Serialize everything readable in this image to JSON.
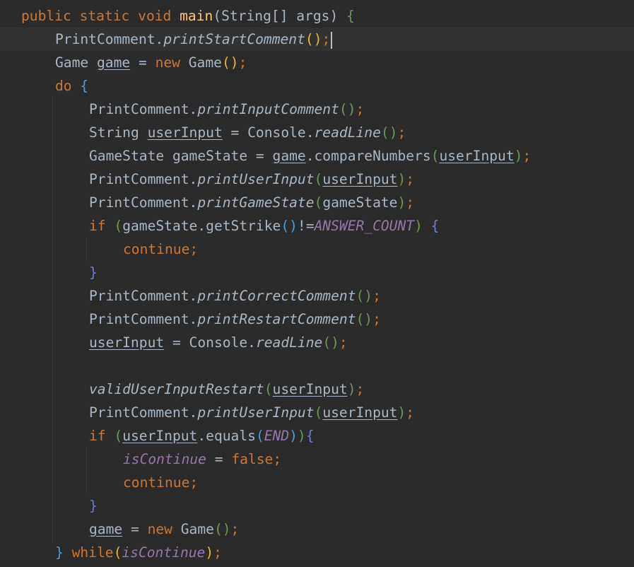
{
  "editor": {
    "lines": [
      {
        "id": "main-signature",
        "tokens": [
          "public",
          " ",
          "static",
          " ",
          "void",
          " ",
          "main",
          "(",
          "String[] args",
          ")",
          " ",
          "{"
        ]
      },
      {
        "id": "print-start",
        "tokens": [
          "PrintComment.",
          "printStartComment",
          "(",
          ")",
          ";"
        ]
      },
      {
        "id": "game-new",
        "tokens": [
          "Game ",
          "game",
          " = ",
          "new",
          " Game",
          "(",
          ")",
          ";"
        ]
      },
      {
        "id": "do-open",
        "tokens": [
          "do",
          " ",
          "{"
        ]
      },
      {
        "id": "print-input",
        "tokens": [
          "PrintComment.",
          "printInputComment",
          "(",
          ")",
          ";"
        ]
      },
      {
        "id": "read-input",
        "tokens": [
          "String ",
          "userInput",
          " = Console.",
          "readLine",
          "(",
          ")",
          ";"
        ]
      },
      {
        "id": "compare",
        "tokens": [
          "GameState gameState = ",
          "game",
          ".compareNumbers",
          "(",
          "userInput",
          ")",
          ";"
        ]
      },
      {
        "id": "print-user-input",
        "tokens": [
          "PrintComment.",
          "printUserInput",
          "(",
          "userInput",
          ")",
          ";"
        ]
      },
      {
        "id": "print-game-state",
        "tokens": [
          "PrintComment.",
          "printGameState",
          "(",
          "gameState",
          ")",
          ";"
        ]
      },
      {
        "id": "if-strike",
        "tokens": [
          "if",
          " ",
          "(",
          "gameState.getStrike",
          "(",
          ")",
          "!=",
          "ANSWER_COUNT",
          ")",
          " ",
          "{"
        ]
      },
      {
        "id": "continue-1",
        "tokens": [
          "continue",
          ";"
        ]
      },
      {
        "id": "close-if-1",
        "tokens": [
          "}"
        ]
      },
      {
        "id": "print-correct",
        "tokens": [
          "PrintComment.",
          "printCorrectComment",
          "(",
          ")",
          ";"
        ]
      },
      {
        "id": "print-restart",
        "tokens": [
          "PrintComment.",
          "printRestartComment",
          "(",
          ")",
          ";"
        ]
      },
      {
        "id": "reread-input",
        "tokens": [
          "userInput",
          " = Console.",
          "readLine",
          "(",
          ")",
          ";"
        ]
      },
      {
        "id": "blank",
        "tokens": [
          ""
        ]
      },
      {
        "id": "valid-restart",
        "tokens": [
          "validUserInputRestart",
          "(",
          "userInput",
          ")",
          ";"
        ]
      },
      {
        "id": "print-user-input-2",
        "tokens": [
          "PrintComment.",
          "printUserInput",
          "(",
          "userInput",
          ")",
          ";"
        ]
      },
      {
        "id": "if-end",
        "tokens": [
          "if",
          " ",
          "(",
          "userInput",
          ".equals",
          "(",
          "END",
          ")",
          ")",
          "{"
        ]
      },
      {
        "id": "is-continue-false",
        "tokens": [
          "isContinue",
          " = ",
          "false",
          ";"
        ]
      },
      {
        "id": "continue-2",
        "tokens": [
          "continue",
          ";"
        ]
      },
      {
        "id": "close-if-2",
        "tokens": [
          "}"
        ]
      },
      {
        "id": "game-new-2",
        "tokens": [
          "game",
          " = ",
          "new",
          " Game",
          "(",
          ")",
          ";"
        ]
      },
      {
        "id": "while",
        "tokens": [
          "}",
          " ",
          "while",
          "(",
          "isContinue",
          ")",
          ";"
        ]
      }
    ]
  }
}
